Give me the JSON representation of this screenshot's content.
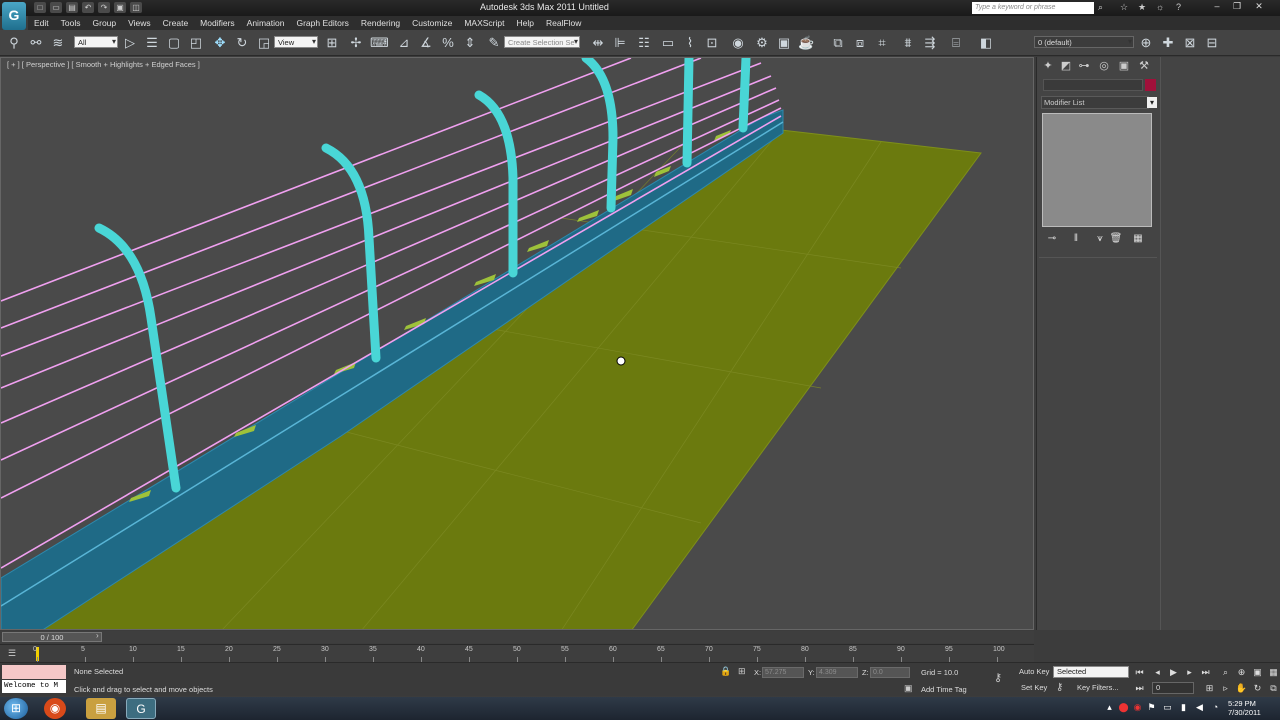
{
  "titlebar": {
    "app_logo": "G",
    "quick_access": [
      "□",
      "▭",
      "▤",
      "↶",
      "↷",
      "▣",
      "◫"
    ],
    "title": "Autodesk 3ds Max 2011     Untitled",
    "search_placeholder": "Type a keyword or phrase",
    "window_buttons": [
      "–",
      "❐",
      "✕"
    ]
  },
  "menu": {
    "items": [
      "Edit",
      "Tools",
      "Group",
      "Views",
      "Create",
      "Modifiers",
      "Animation",
      "Graph Editors",
      "Rendering",
      "Customize",
      "MAXScript",
      "Help",
      "RealFlow"
    ]
  },
  "toolbar": {
    "selection_filter": "All",
    "reference_coord": "View",
    "named_selection": "Create Selection Se",
    "layer": "0 (default)"
  },
  "viewport": {
    "label": "[ + ] [ Perspective ] [ Smooth + Highlights + Edged Faces ]"
  },
  "command_panel": {
    "modifier_list": "Modifier List",
    "object_color": "#a0103a"
  },
  "timeline": {
    "slider_label": "0 / 100",
    "ticks": [
      "0",
      "5",
      "10",
      "15",
      "20",
      "25",
      "30",
      "35",
      "40",
      "45",
      "50",
      "55",
      "60",
      "65",
      "70",
      "75",
      "80",
      "85",
      "90",
      "95",
      "100"
    ]
  },
  "status": {
    "selection": "None Selected",
    "prompt": "Click and drag to select and move objects",
    "maxscript_welcome": "Welcome to M",
    "x_label": "X:",
    "y_label": "Y:",
    "z_label": "Z:",
    "x_value": "57.275",
    "y_value": "4.309",
    "z_value": "0.0",
    "grid": "Grid = 10.0",
    "add_time_tag": "Add Time Tag",
    "auto_key": "Auto Key",
    "set_key": "Set Key",
    "key_mode": "Selected",
    "key_filters": "Key Filters...",
    "frame": "0"
  },
  "taskbar": {
    "time": "5:29 PM",
    "date": "7/30/2011"
  }
}
